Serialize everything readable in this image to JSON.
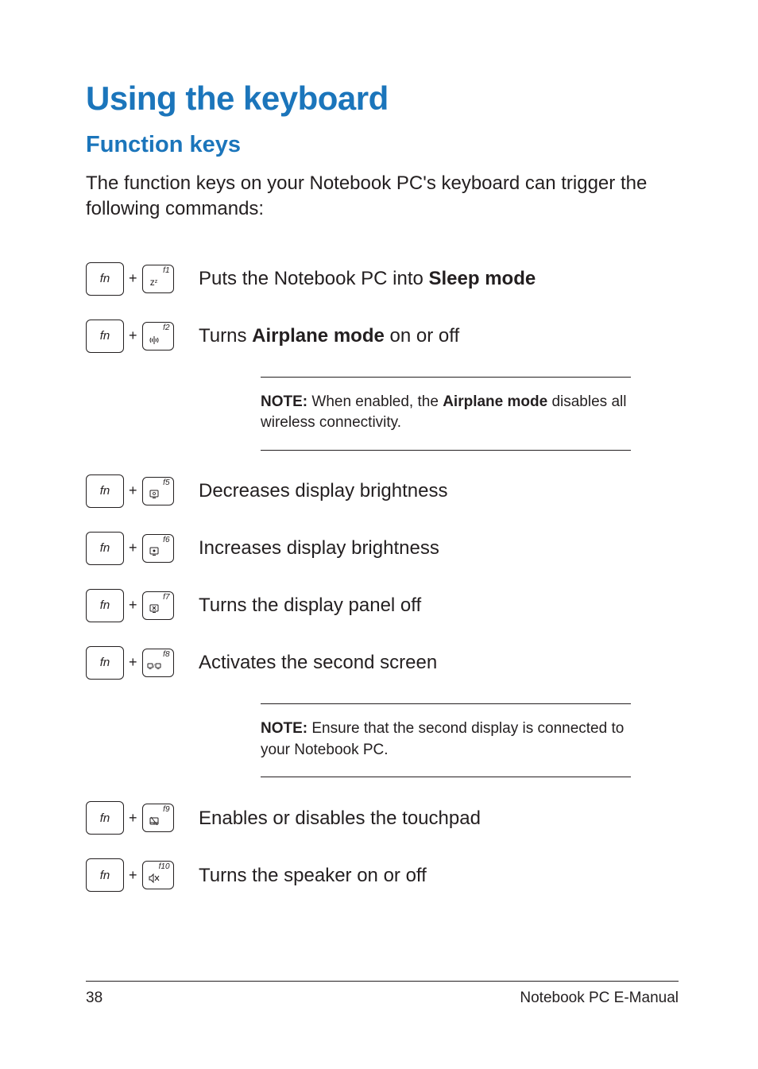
{
  "title": "Using the keyboard",
  "subtitle": "Function keys",
  "intro": "The function keys on your Notebook PC's keyboard can trigger the following commands:",
  "fn_label": "fn",
  "plus": "+",
  "rows": {
    "r1": {
      "flabel": "f1",
      "icon": "zz",
      "text_pre": "Puts the Notebook PC into ",
      "bold": "Sleep mode",
      "text_post": ""
    },
    "r2": {
      "flabel": "f2",
      "icon": "antenna",
      "text_pre": "Turns ",
      "bold": "Airplane mode",
      "text_post": " on or off"
    },
    "r3": {
      "flabel": "f5",
      "icon": "sun-dim",
      "text_pre": "Decreases display brightness",
      "bold": "",
      "text_post": ""
    },
    "r4": {
      "flabel": "f6",
      "icon": "sun-bright",
      "text_pre": "Increases display brightness",
      "bold": "",
      "text_post": ""
    },
    "r5": {
      "flabel": "f7",
      "icon": "display-off",
      "text_pre": "Turns the display panel off",
      "bold": "",
      "text_post": ""
    },
    "r6": {
      "flabel": "f8",
      "icon": "dual-screen",
      "text_pre": "Activates the second screen",
      "bold": "",
      "text_post": ""
    },
    "r7": {
      "flabel": "f9",
      "icon": "touchpad",
      "text_pre": "Enables or disables the touchpad",
      "bold": "",
      "text_post": ""
    },
    "r8": {
      "flabel": "f10",
      "icon": "mute",
      "text_pre": "Turns the speaker on or off",
      "bold": "",
      "text_post": ""
    }
  },
  "note1": {
    "bold1": "NOTE:",
    "mid": " When enabled, the ",
    "bold2": "Airplane mode",
    "post": " disables all wireless connectivity."
  },
  "note2": {
    "bold1": "NOTE:",
    "post": " Ensure that the second display is connected to your Notebook PC."
  },
  "footer": {
    "page": "38",
    "doc": "Notebook PC E-Manual"
  }
}
